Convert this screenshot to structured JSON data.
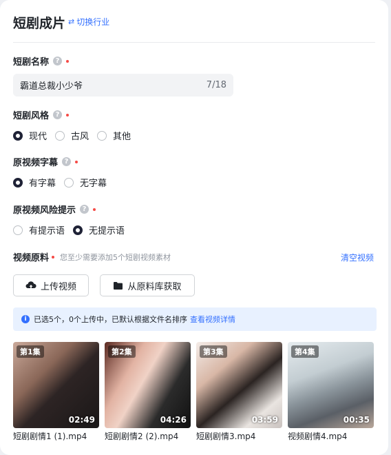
{
  "header": {
    "title": "短剧成片",
    "switch_label": "切换行业"
  },
  "fields": {
    "name": {
      "label": "短剧名称",
      "value": "霸道总裁小少爷",
      "count": "7/18"
    },
    "style": {
      "label": "短剧风格",
      "options": [
        "现代",
        "古风",
        "其他"
      ],
      "selected": "现代"
    },
    "subtitle": {
      "label": "原视频字幕",
      "options": [
        "有字幕",
        "无字幕"
      ],
      "selected": "有字幕"
    },
    "risk": {
      "label": "原视频风险提示",
      "options": [
        "有提示语",
        "无提示语"
      ],
      "selected": "无提示语"
    },
    "material": {
      "label": "视频原料",
      "hint": "您至少需要添加5个短剧视频素材",
      "clear_label": "清空视频"
    }
  },
  "buttons": {
    "upload": "上传视频",
    "library": "从原料库获取"
  },
  "notice": {
    "text": "已选5个，0个上传中，已默认根据文件名排序",
    "link": "查看视频详情"
  },
  "videos": [
    {
      "episode": "第1集",
      "duration": "02:49",
      "filename": "短剧剧情1 (1).mp4"
    },
    {
      "episode": "第2集",
      "duration": "04:26",
      "filename": "短剧剧情2 (2).mp4"
    },
    {
      "episode": "第3集",
      "duration": "03:59",
      "filename": "短剧剧情3.mp4"
    },
    {
      "episode": "第4集",
      "duration": "00:35",
      "filename": "视频剧情4.mp4"
    }
  ],
  "colors": {
    "accent": "#3370ff",
    "required": "#f54a45",
    "radio_checked": "#1f2236"
  }
}
